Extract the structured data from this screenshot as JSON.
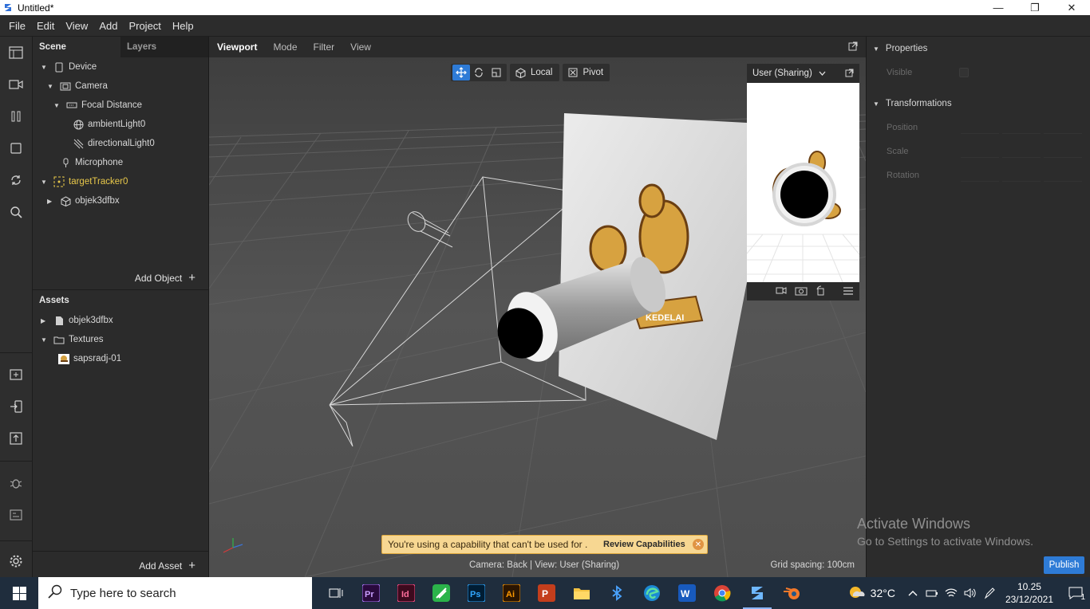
{
  "window": {
    "title": "Untitled*",
    "controls": [
      "minimize-icon",
      "restore-icon",
      "close-icon"
    ]
  },
  "menu": [
    "File",
    "Edit",
    "View",
    "Add",
    "Project",
    "Help"
  ],
  "scene_panel": {
    "tabs": [
      "Scene",
      "Layers"
    ],
    "tree": [
      {
        "label": "Device",
        "icon": "device-icon"
      },
      {
        "label": "Camera",
        "icon": "camera-icon"
      },
      {
        "label": "Focal Distance",
        "icon": "focal-distance-icon"
      },
      {
        "label": "ambientLight0",
        "icon": "ambient-light-icon"
      },
      {
        "label": "directionalLight0",
        "icon": "directional-light-icon"
      },
      {
        "label": "Microphone",
        "icon": "microphone-icon"
      },
      {
        "label": "targetTracker0",
        "icon": "target-tracker-icon"
      },
      {
        "label": "objek3dfbx",
        "icon": "cube-icon"
      }
    ],
    "add_object": "Add Object",
    "assets_title": "Assets",
    "assets": [
      {
        "label": "objek3dfbx",
        "icon": "file-icon"
      },
      {
        "label": "Textures",
        "icon": "folder-icon"
      },
      {
        "label": "sapsradj-01",
        "icon": "texture-thumbnail"
      }
    ],
    "add_asset": "Add Asset"
  },
  "viewport": {
    "tabs": [
      "Viewport",
      "Mode",
      "Filter",
      "View"
    ],
    "toolbar": {
      "local": "Local",
      "pivot": "Pivot"
    },
    "preview": {
      "device": "User (Sharing)"
    },
    "warning": {
      "text": "You're using a capability that can't be used for .",
      "action": "Review Capabilities"
    },
    "status_camera": "Camera: Back | View: User (Sharing)",
    "grid_spacing": "Grid spacing: 100cm",
    "billboard_text": "KEDELAI"
  },
  "properties": {
    "section1": "Properties",
    "visible_label": "Visible",
    "section2": "Transformations",
    "rows": [
      "Position",
      "Scale",
      "Rotation"
    ],
    "publish": "Publish",
    "watermark_line1": "Activate Windows",
    "watermark_line2": "Go to Settings to activate Windows."
  },
  "taskbar": {
    "search_placeholder": "Type here to search",
    "apps": [
      "task-view-icon",
      "premiere-pro-icon",
      "indesign-icon",
      "green-app-icon",
      "photoshop-icon",
      "illustrator-icon",
      "powerpoint-icon",
      "file-explorer-icon",
      "bluetooth-icon",
      "edge-icon",
      "word-icon",
      "chrome-icon",
      "spark-ar-icon",
      "blender-icon"
    ],
    "temperature": "32°C",
    "time": "10.25",
    "date": "23/12/2021",
    "notification_count": "1"
  },
  "colors": {
    "accent": "#2e7bd6",
    "highlight": "#e8c84a",
    "warning_bg": "#f7d792"
  }
}
